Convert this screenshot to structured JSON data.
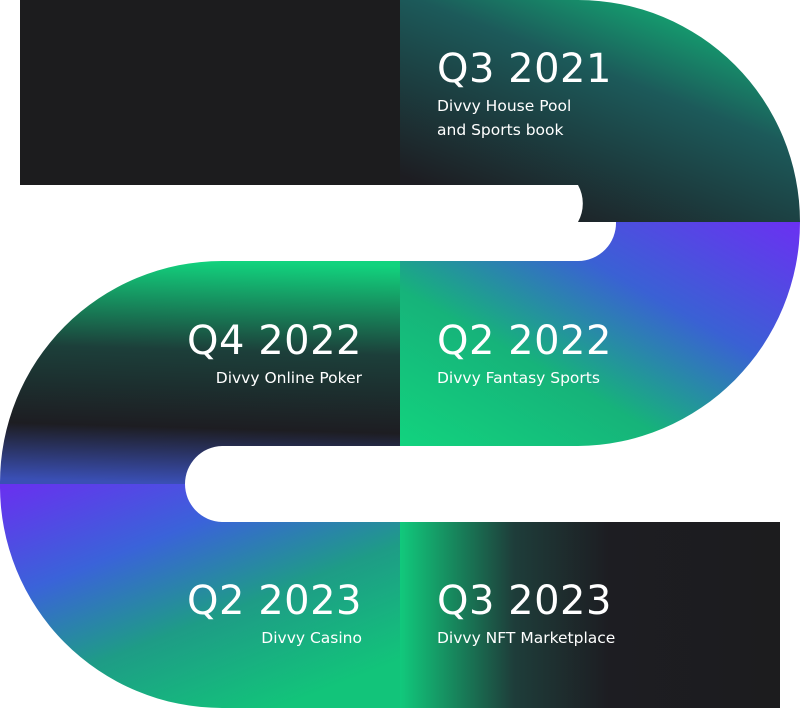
{
  "milestones": [
    {
      "quarter": "Q3 2021",
      "desc_lines": [
        "Divvy House Pool",
        "and Sports book"
      ]
    },
    {
      "quarter": "Q4 2022",
      "desc_lines": [
        "Divvy Online Poker"
      ]
    },
    {
      "quarter": "Q2 2022",
      "desc_lines": [
        "Divvy Fantasy Sports"
      ]
    },
    {
      "quarter": "Q2 2023",
      "desc_lines": [
        "Divvy Casino"
      ]
    },
    {
      "quarter": "Q3 2023",
      "desc_lines": [
        "Divvy NFT Marketplace"
      ]
    }
  ],
  "colors": {
    "dark": "#1c1c1e",
    "green": "#12d37e",
    "purple": "#6a2ff0",
    "blue": "#3a63d9",
    "teal": "#1fa08a"
  }
}
